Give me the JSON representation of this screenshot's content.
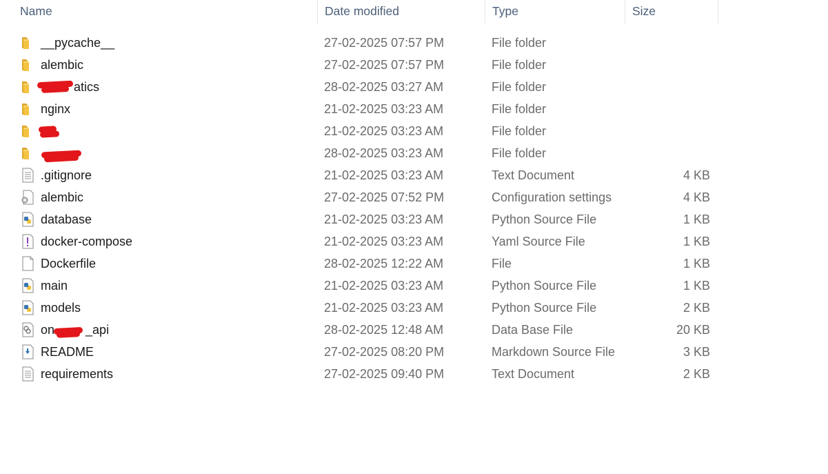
{
  "columns": {
    "name": "Name",
    "date": "Date modified",
    "type": "Type",
    "size": "Size"
  },
  "colors": {
    "folder": "#f5c342",
    "python": "#3a75b0",
    "yaml": "#8a3fb5",
    "markdown": "#2c6db5",
    "redaction": "#e3171b"
  },
  "files": [
    {
      "name": "__pycache__",
      "date": "27-02-2025 07:57 PM",
      "type": "File folder",
      "size": "",
      "icon": "folder-icon"
    },
    {
      "name": "alembic",
      "date": "27-02-2025 07:57 PM",
      "type": "File folder",
      "size": "",
      "icon": "folder-icon"
    },
    {
      "name": "atics",
      "date": "28-02-2025 03:27 AM",
      "type": "File folder",
      "size": "",
      "icon": "folder-icon"
    },
    {
      "name": "nginx",
      "date": "21-02-2025 03:23 AM",
      "type": "File folder",
      "size": "",
      "icon": "folder-icon"
    },
    {
      "name": "",
      "date": "21-02-2025 03:23 AM",
      "type": "File folder",
      "size": "",
      "icon": "folder-icon"
    },
    {
      "name": "",
      "date": "28-02-2025 03:23 AM",
      "type": "File folder",
      "size": "",
      "icon": "folder-icon"
    },
    {
      "name": ".gitignore",
      "date": "21-02-2025 03:23 AM",
      "type": "Text Document",
      "size": "4 KB",
      "icon": "text-document-icon"
    },
    {
      "name": "alembic",
      "date": "27-02-2025 07:52 PM",
      "type": "Configuration settings",
      "size": "4 KB",
      "icon": "config-settings-icon"
    },
    {
      "name": "database",
      "date": "21-02-2025 03:23 AM",
      "type": "Python Source File",
      "size": "1 KB",
      "icon": "python-file-icon"
    },
    {
      "name": "docker-compose",
      "date": "21-02-2025 03:23 AM",
      "type": "Yaml Source File",
      "size": "1 KB",
      "icon": "yaml-file-icon"
    },
    {
      "name": "Dockerfile",
      "date": "28-02-2025 12:22 AM",
      "type": "File",
      "size": "1 KB",
      "icon": "blank-file-icon"
    },
    {
      "name": "main",
      "date": "21-02-2025 03:23 AM",
      "type": "Python Source File",
      "size": "1 KB",
      "icon": "python-file-icon"
    },
    {
      "name": "models",
      "date": "21-02-2025 03:23 AM",
      "type": "Python Source File",
      "size": "2 KB",
      "icon": "python-file-icon"
    },
    {
      "name": "on_api",
      "date": "28-02-2025 12:48 AM",
      "type": "Data Base File",
      "size": "20 KB",
      "icon": "database-file-icon"
    },
    {
      "name": "README",
      "date": "27-02-2025 08:20 PM",
      "type": "Markdown Source File",
      "size": "3 KB",
      "icon": "markdown-file-icon"
    },
    {
      "name": "requirements",
      "date": "27-02-2025 09:40 PM",
      "type": "Text Document",
      "size": "2 KB",
      "icon": "text-document-icon"
    }
  ]
}
